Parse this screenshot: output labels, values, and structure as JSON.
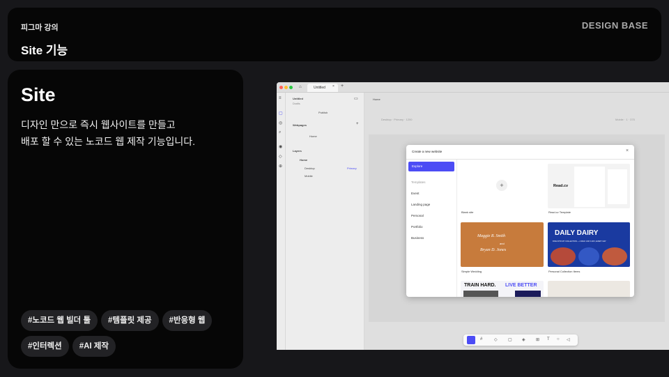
{
  "header": {
    "subtitle": "피그마 강의",
    "title": "Site 기능",
    "brand": "DESIGN BASE"
  },
  "card": {
    "title": "Site",
    "desc_line1": "디자인 만으로 즉시 웹사이트를 만들고",
    "desc_line2": "배포 할 수 있는 노코드 웹 제작 기능입니다.",
    "tags": [
      "#노코드 웹 빌더 툴",
      "#템플릿 제공",
      "#반응형 웹",
      "#인터렉션",
      "#AI 제작"
    ]
  },
  "screenshot": {
    "tab": "Untitled",
    "file_name": "Untitled",
    "file_sub": "Drafts",
    "publish": "Publish",
    "webpages_label": "Webpages",
    "home_page": "Home",
    "layers_label": "Layers",
    "layer_home": "Home",
    "layer_desktop": "Desktop",
    "layer_primary": "Primary",
    "layer_mobile": "Mobile",
    "canvas_breadcrumb": "Home",
    "breakpoint_left": "Desktop · Primary · 1200",
    "breakpoint_right": "Mobile · 1 · 375",
    "modal": {
      "title": "Create a new website",
      "nav_explore": "Explore",
      "nav_templates": "Templates",
      "nav_items": [
        "Event",
        "Landing page",
        "Personal",
        "Portfolio",
        "Business"
      ],
      "templates": {
        "blank": "Blank site",
        "readcv": "Read.cv Template",
        "readcv_logo": "Read.cv",
        "wedding": "Simple Wedding",
        "wedding_names_1": "Maggie R. Smith",
        "wedding_and": "and",
        "wedding_names_2": "Bryan D. Jones",
        "dairy": "Personal Collection Items",
        "dairy_title": "DAILY DAIRY",
        "dairy_sub": "DIVE INTO MY COLLECTION — A MILK CAP A DAY, EVERY DAY",
        "train_title": "TRAIN HARD.",
        "train_title_2": "LIVE BETTER"
      }
    }
  },
  "colors": {
    "accent": "#4c4cf5",
    "bg": "#17171a",
    "card": "#060606",
    "tag": "#222225",
    "brand": "#a9a9a9",
    "wedding": "#c77b3c",
    "dairy": "#1a3aa0"
  }
}
